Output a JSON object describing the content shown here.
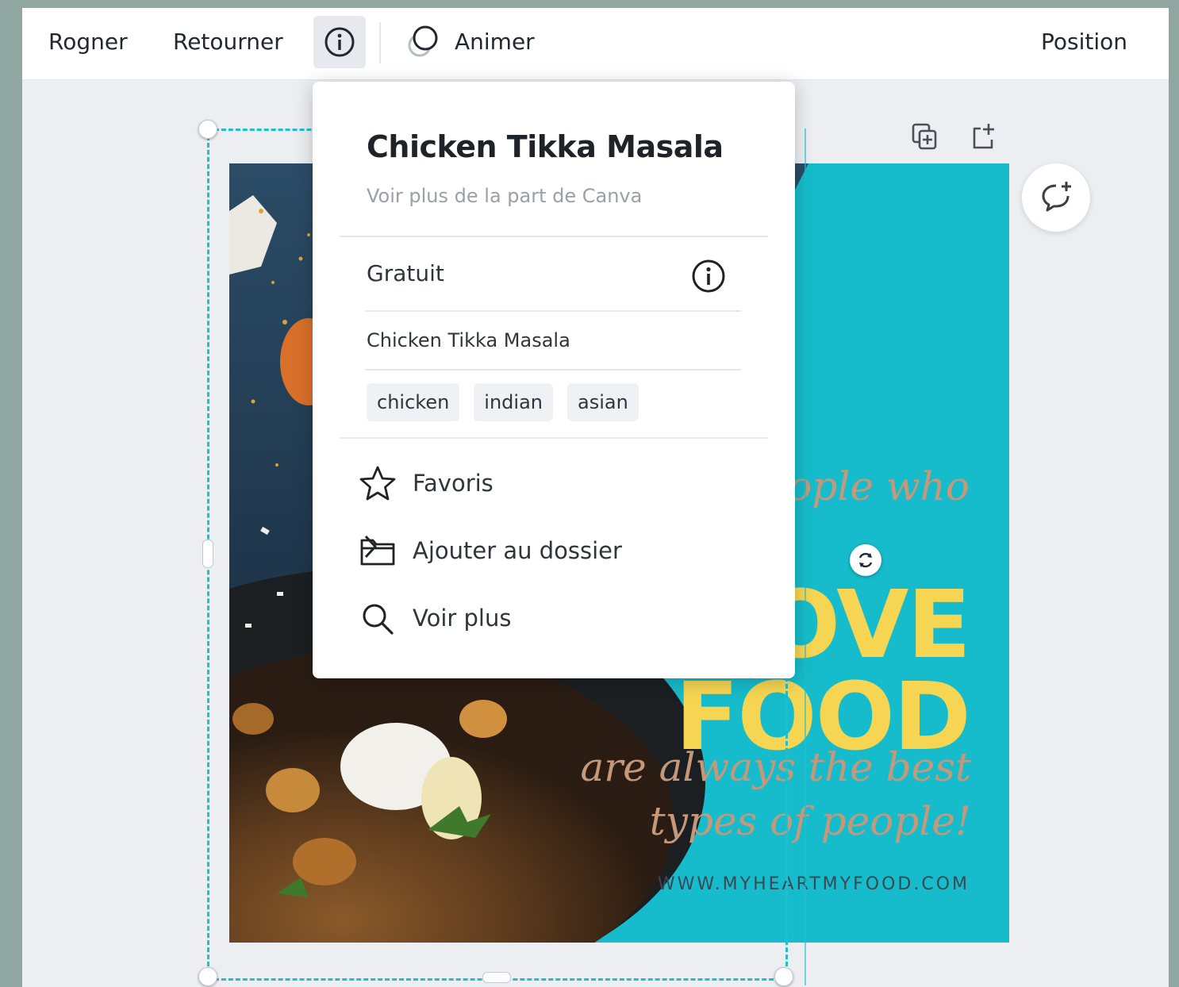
{
  "toolbar": {
    "crop_label": "Rogner",
    "flip_label": "Retourner",
    "info_icon": "info-icon",
    "animate_label": "Animer",
    "position_label": "Position"
  },
  "popup": {
    "title": "Chicken Tikka Masala",
    "subtitle": "Voir plus de la part de Canva",
    "price_label": "Gratuit",
    "element_name": "Chicken Tikka Masala",
    "tags": [
      "chicken",
      "indian",
      "asian"
    ],
    "menu": {
      "favorites": "Favoris",
      "add_to_folder": "Ajouter au dossier",
      "see_more": "Voir plus"
    }
  },
  "design": {
    "line1": "people who",
    "line2": "OVE",
    "line3": "FOOD",
    "line4": "are always the best",
    "line5": "types of people!",
    "website": "WWW.MYHEARTMYFOOD.COM"
  },
  "colors": {
    "teal": "#16bccb",
    "yellow": "#f6d552",
    "script": "#c69879",
    "selection": "#1fbfcc"
  }
}
